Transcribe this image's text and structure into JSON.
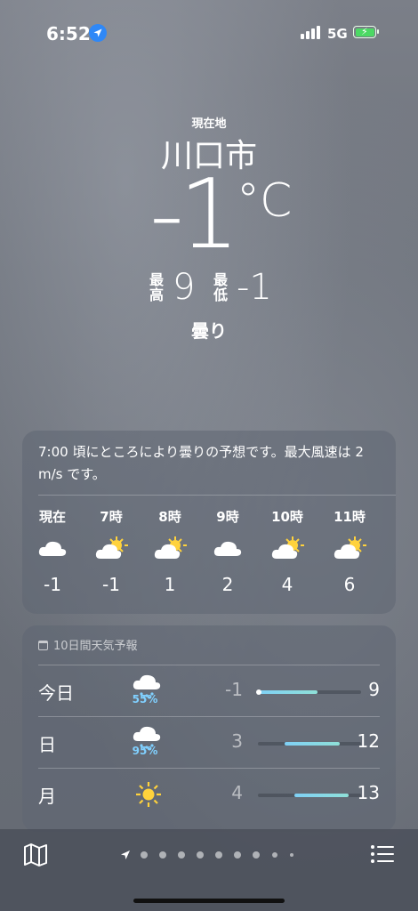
{
  "status": {
    "time": "6:52",
    "network": "5G"
  },
  "header": {
    "location_label": "現在地",
    "city": "川口市",
    "temperature": "-1",
    "unit": "°C",
    "high_label": "最高",
    "high": "9",
    "low_label": "最低",
    "low": "-1",
    "condition": "曇り"
  },
  "hourly": {
    "summary": "7:00 頃にところにより曇りの予想です。最大風速は 2 m/s です。",
    "items": [
      {
        "label": "現在",
        "icon": "cloud-icon",
        "temp": "-1"
      },
      {
        "label": "7時",
        "icon": "partly-sunny-icon",
        "temp": "-1"
      },
      {
        "label": "8時",
        "icon": "partly-sunny-icon",
        "temp": "1"
      },
      {
        "label": "9時",
        "icon": "cloud-icon",
        "temp": "2"
      },
      {
        "label": "10時",
        "icon": "partly-sunny-icon",
        "temp": "4"
      },
      {
        "label": "11時",
        "icon": "partly-sunny-icon",
        "temp": "6"
      }
    ]
  },
  "daily": {
    "header": "10日間天気予報",
    "rows": [
      {
        "day": "今日",
        "icon": "rain-cloud-icon",
        "precip": "55%",
        "low": "-1",
        "high": "9",
        "range_start": 0.0,
        "range_end": 0.58,
        "current": 0.0
      },
      {
        "day": "日",
        "icon": "rain-cloud-icon",
        "precip": "95%",
        "low": "3",
        "high": "12",
        "range_start": 0.26,
        "range_end": 0.79
      },
      {
        "day": "月",
        "icon": "sun-icon",
        "precip": "",
        "low": "4",
        "high": "13",
        "range_start": 0.35,
        "range_end": 0.88
      }
    ]
  },
  "colors": {
    "accent_blue": "#2f88f7",
    "precip": "#80d0ff",
    "sun": "#ffd23c"
  }
}
